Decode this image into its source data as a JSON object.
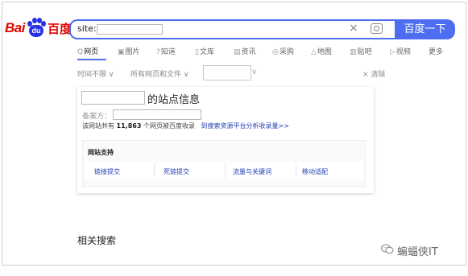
{
  "logo": {
    "text_bai": "Bai",
    "text_paw": "du",
    "text_du": "百度"
  },
  "search": {
    "query_prefix": "site:",
    "clear_glyph": "×",
    "button_label": "百度一下"
  },
  "tabs": [
    {
      "icon": "Q",
      "label": "网页"
    },
    {
      "icon": "▣",
      "label": "图片"
    },
    {
      "icon": "?",
      "label": "知道"
    },
    {
      "icon": "▯",
      "label": "文库"
    },
    {
      "icon": "▤",
      "label": "资讯"
    },
    {
      "icon": "◎",
      "label": "采购"
    },
    {
      "icon": "△",
      "label": "地图"
    },
    {
      "icon": "▥",
      "label": "贴吧"
    },
    {
      "icon": "▷",
      "label": "视频"
    },
    {
      "icon": "",
      "label": "更多"
    }
  ],
  "filters": {
    "time": "时间不限 ∨",
    "scope": "所有网页和文件 ∨",
    "chevron": "∨",
    "clear": "× 清除"
  },
  "card": {
    "title": "的站点信息",
    "beian_label": "备案方：",
    "stat_prefix": "该网站共有",
    "stat_count": "11,863",
    "stat_suffix": "个网页被百度收录",
    "stat_link": "到搜索资源平台分析收录量>>",
    "support_heading": "网站支持",
    "support_links": [
      "链接提交",
      "死链提交",
      "流量与关键词",
      "移动适配"
    ]
  },
  "related": {
    "label": "相关搜索"
  },
  "watermark": {
    "icon": "wechat-icon",
    "text": "蝙蝠侠IT"
  }
}
